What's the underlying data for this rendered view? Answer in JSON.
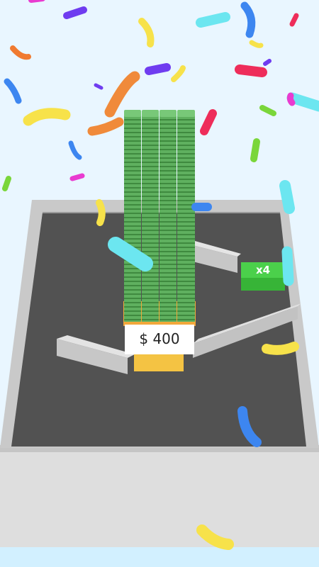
{
  "hud": {
    "price_text": "$ 400",
    "multiplier_text": "x4"
  },
  "colors": {
    "background": "#e9f6ff",
    "floor": "#505050",
    "wall": "#c8c8c8",
    "money": "#4a9b4a",
    "base": "#f5c542",
    "multiplier_pad": "#3ac43a"
  },
  "game_state": {
    "money_stacks": 4
  },
  "icons": [
    "confetti-piece",
    "money-stack",
    "divider-wall",
    "cash-register-base"
  ]
}
